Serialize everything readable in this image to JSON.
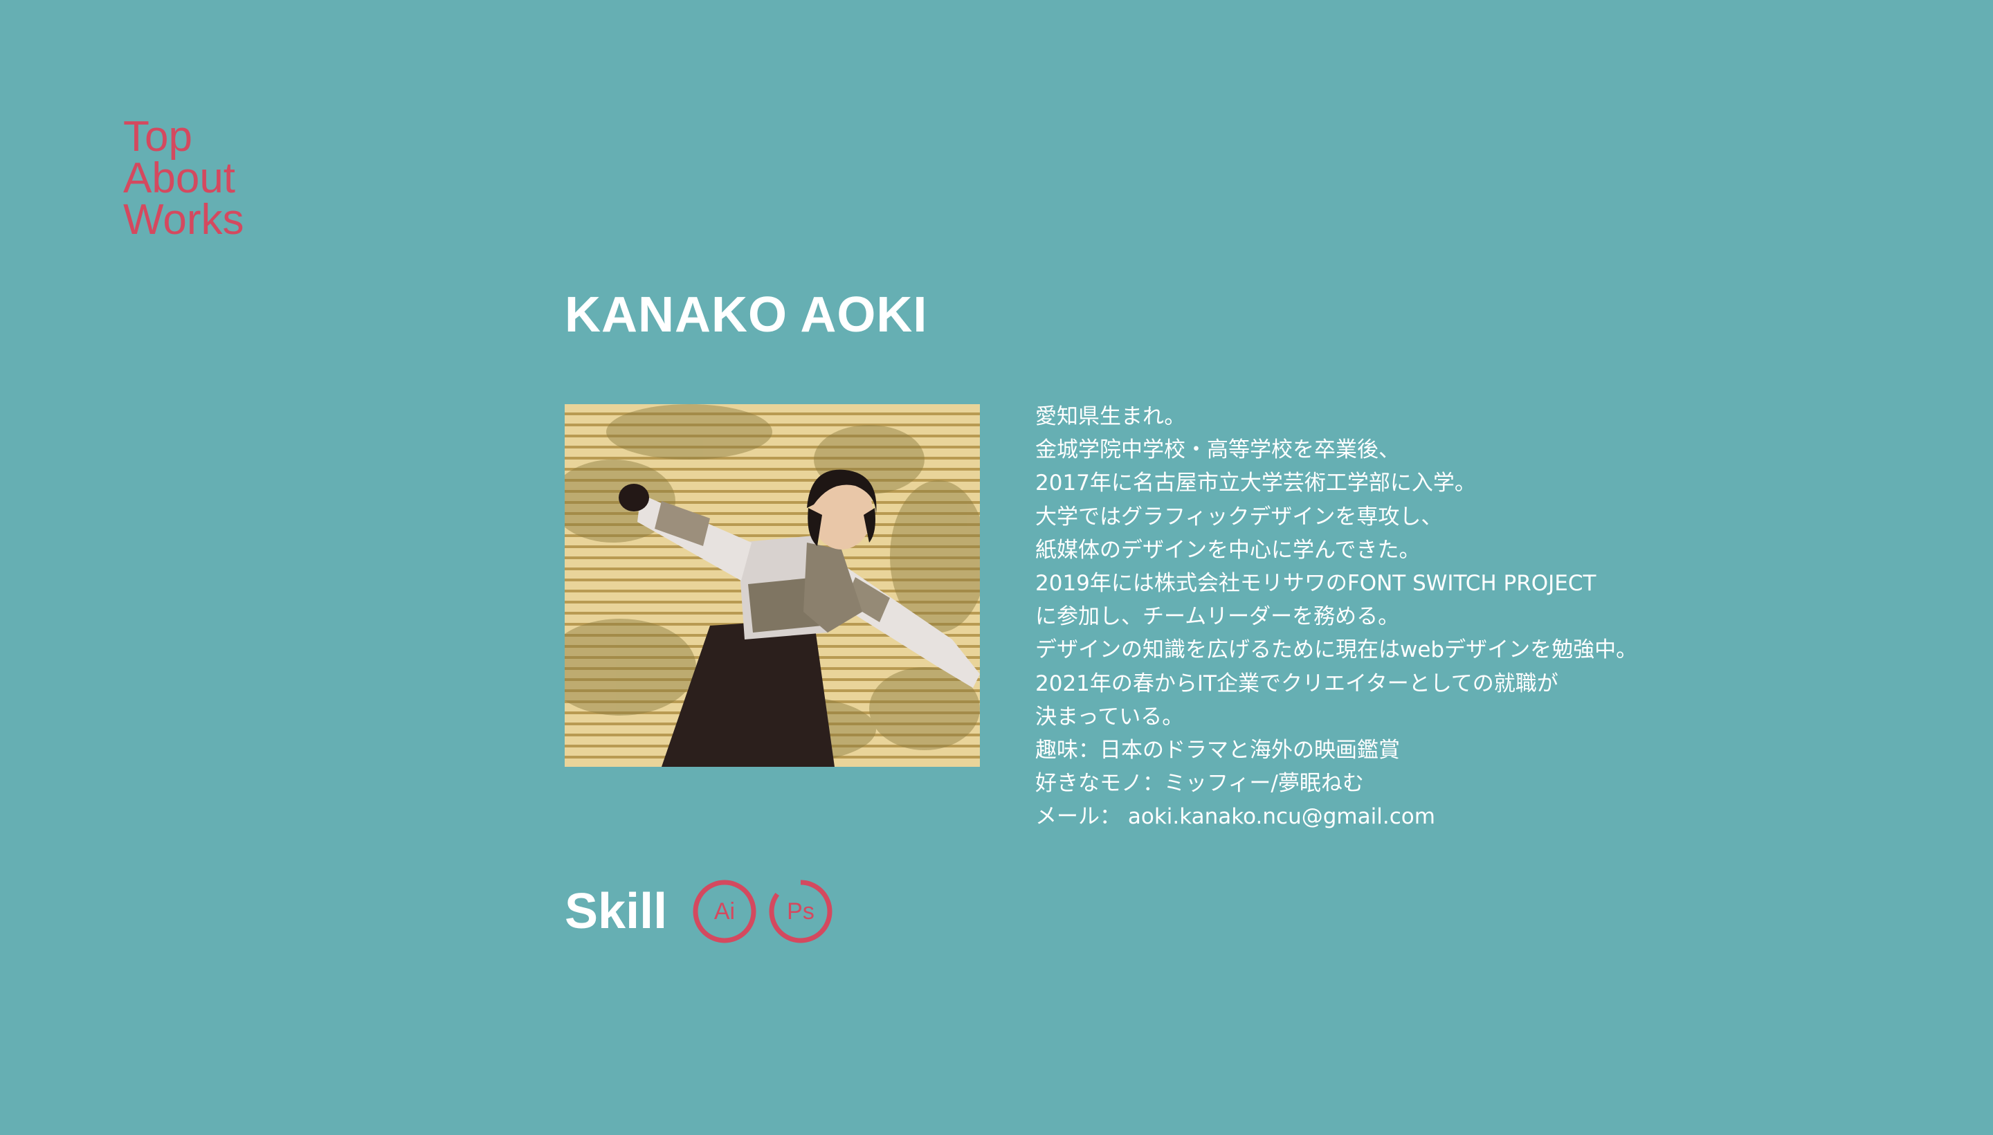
{
  "nav": {
    "items": [
      {
        "label": "Top"
      },
      {
        "label": "About"
      },
      {
        "label": "Works"
      }
    ]
  },
  "profile": {
    "name": "KANAKO AOKI",
    "photo_icon": "profile-photo",
    "bio": [
      "愛知県生まれ。",
      "金城学院中学校・高等学校を卒業後、",
      "2017年に名古屋市立大学芸術工学部に入学。",
      "大学ではグラフィックデザインを専攻し、",
      "紙媒体のデザインを中心に学んできた。",
      "2019年には株式会社モリサワのFONT SWITCH PROJECT",
      "に参加し、チームリーダーを務める。",
      "デザインの知識を広げるために現在はwebデザインを勉強中。",
      "2021年の春からIT企業でクリエイターとしての就職が",
      "決まっている。",
      "趣味：日本のドラマと海外の映画鑑賞",
      "好きなモノ：ミッフィー/夢眠ねむ",
      "メール： aoki.kanako.ncu@gmail.com"
    ]
  },
  "skills": {
    "title": "Skill",
    "items": [
      {
        "icon": "illustrator-icon",
        "label": "Ai",
        "level": 1.0
      },
      {
        "icon": "photoshop-icon",
        "label": "Ps",
        "level": 0.85
      }
    ]
  },
  "colors": {
    "background": "#66afb3",
    "accent": "#d4495f",
    "text": "#ffffff"
  }
}
